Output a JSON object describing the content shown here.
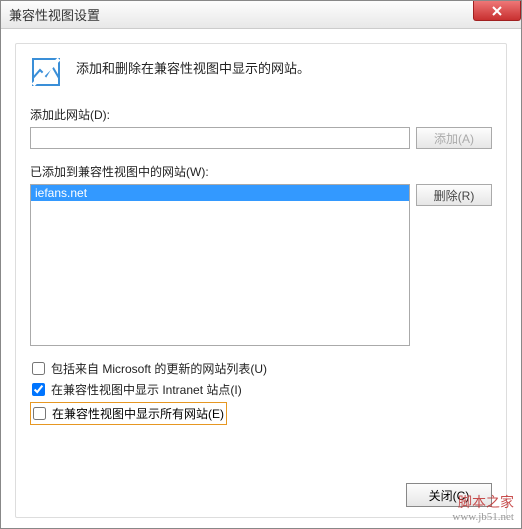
{
  "titlebar": {
    "text": "兼容性视图设置"
  },
  "header": {
    "description": "添加和删除在兼容性视图中显示的网站。"
  },
  "add_section": {
    "label": "添加此网站(D):",
    "value": "",
    "button": "添加(A)"
  },
  "list_section": {
    "label": "已添加到兼容性视图中的网站(W):",
    "remove_button": "删除(R)",
    "items": [
      "iefans.net"
    ]
  },
  "checkboxes": {
    "ms_list": {
      "label": "包括来自 Microsoft 的更新的网站列表(U)",
      "checked": false
    },
    "intranet": {
      "label": "在兼容性视图中显示 Intranet 站点(I)",
      "checked": true
    },
    "all_sites": {
      "label": "在兼容性视图中显示所有网站(E)",
      "checked": false
    }
  },
  "close_button": "关闭(C)",
  "watermark": {
    "text": "脚本之家",
    "url": "www.jb51.net"
  }
}
